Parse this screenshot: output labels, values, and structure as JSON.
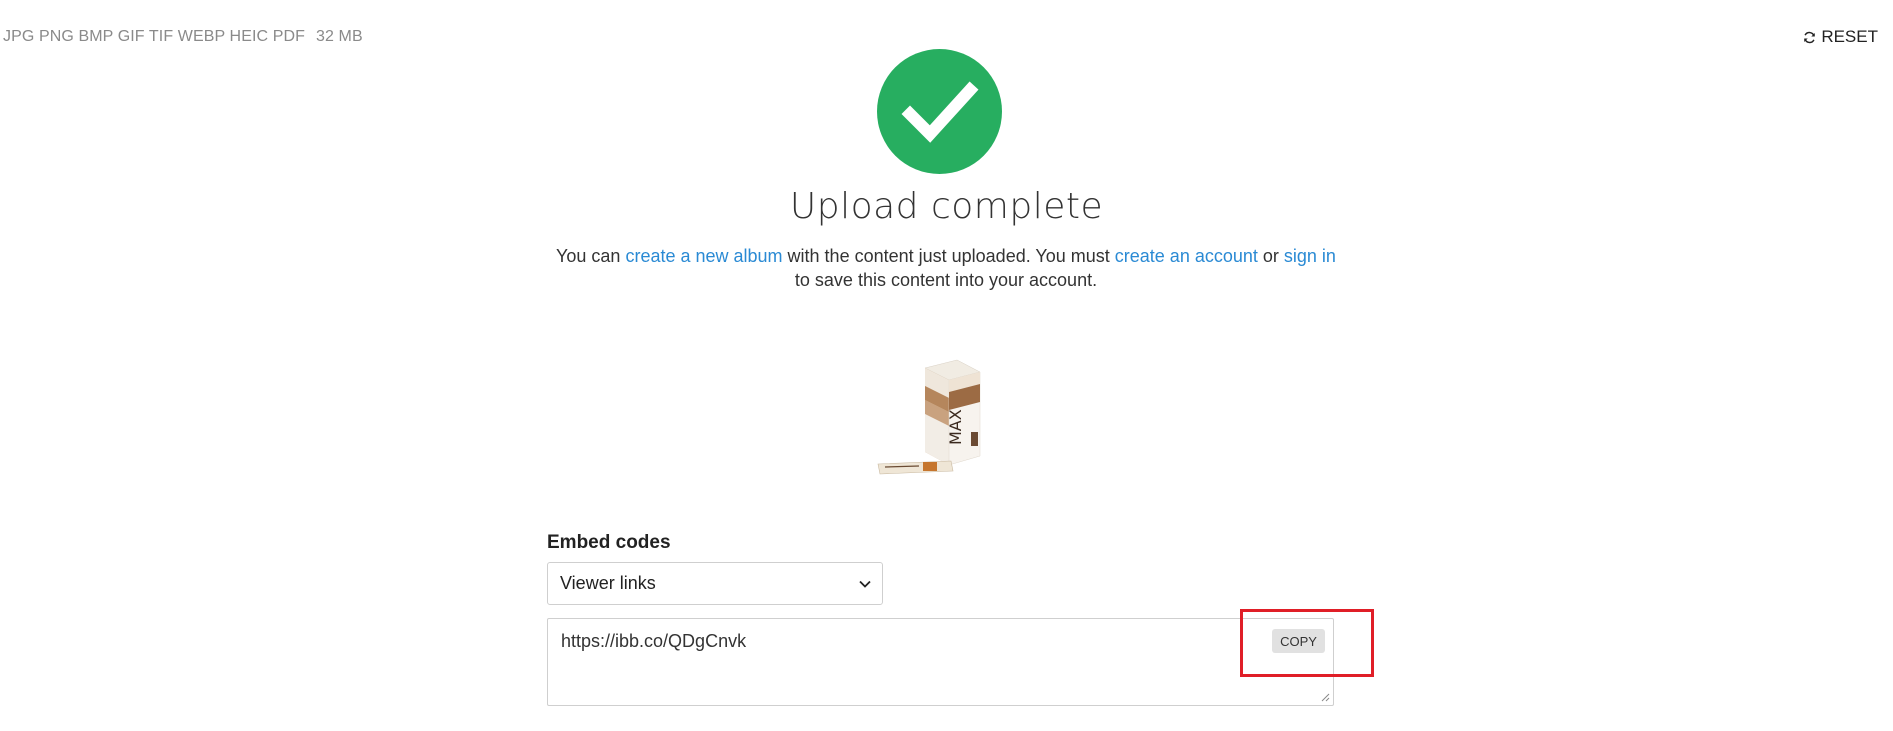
{
  "header": {
    "formats": "JPG PNG BMP GIF TIF WEBP HEIC PDF",
    "max_size": "32 MB",
    "reset_label": "RESET",
    "reset_icon": "refresh-icon"
  },
  "status": {
    "icon": "check-icon",
    "color": "#27ae60",
    "title": "Upload complete"
  },
  "message": {
    "part1": "You can ",
    "link_album": "create a new album",
    "part2": " with the content just uploaded. You must ",
    "link_account": "create an account",
    "part3": " or ",
    "link_signin": "sign in",
    "part4": " to save this content into your account."
  },
  "embed": {
    "label": "Embed codes",
    "selected_option": "Viewer links",
    "code_value": "https://ibb.co/QDgCnvk",
    "copy_label": "COPY"
  },
  "colors": {
    "link": "#2a8ad4",
    "highlight": "#e01e27"
  }
}
